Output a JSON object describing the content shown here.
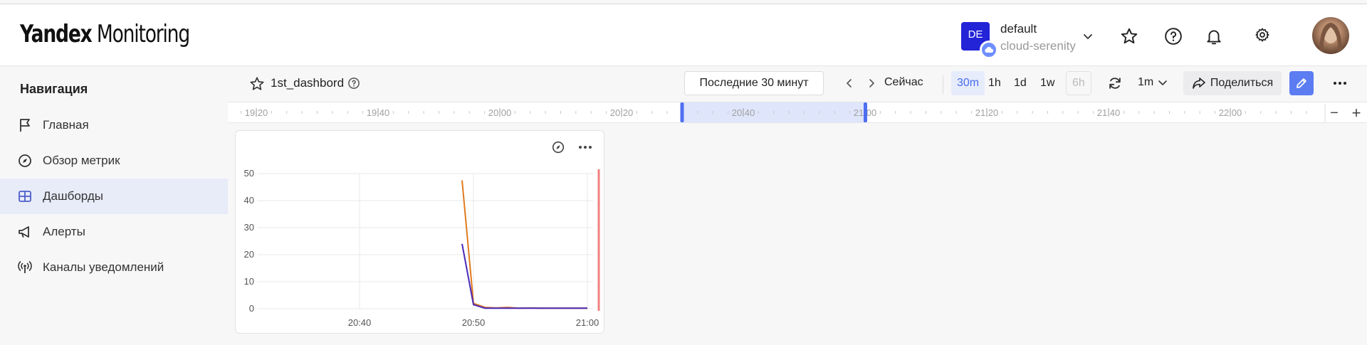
{
  "header": {
    "logo_bold": "Yandex",
    "logo_light": " Monitoring",
    "account": {
      "badge": "DE",
      "name": "default",
      "subtitle": "cloud-serenity"
    },
    "icons": [
      "star-icon",
      "help-icon",
      "bell-icon",
      "gear-icon"
    ]
  },
  "sidebar": {
    "title": "Навигация",
    "items": [
      {
        "label": "Главная",
        "icon": "flag-icon",
        "active": false
      },
      {
        "label": "Обзор метрик",
        "icon": "compass-icon",
        "active": false
      },
      {
        "label": "Дашборды",
        "icon": "dashboard-icon",
        "active": true
      },
      {
        "label": "Алерты",
        "icon": "megaphone-icon",
        "active": false
      },
      {
        "label": "Каналы уведомлений",
        "icon": "broadcast-icon",
        "active": false
      }
    ]
  },
  "dashboard": {
    "name": "1st_dashbord",
    "range_label": "Последние 30 минут",
    "now_label": "Сейчас",
    "periods": [
      {
        "label": "30m",
        "state": "active"
      },
      {
        "label": "1h",
        "state": "normal"
      },
      {
        "label": "1d",
        "state": "normal"
      },
      {
        "label": "1w",
        "state": "normal"
      },
      {
        "label": "6h",
        "state": "disabled"
      }
    ],
    "refresh_interval": "1m",
    "share_label": "Поделиться"
  },
  "timeline": {
    "labels": [
      "19:20",
      "19:40",
      "20:00",
      "20:20",
      "20:40",
      "21:00",
      "21:20",
      "21:40",
      "22:00"
    ],
    "selection": [
      "20:30",
      "21:00"
    ],
    "zoom_out": "−",
    "zoom_in": "+"
  },
  "chart_data": {
    "type": "line",
    "x_unit": "time (HH:MM)",
    "xticks": [
      "20:40",
      "20:50",
      "21:00"
    ],
    "yticks": [
      0,
      10,
      20,
      30,
      40,
      50
    ],
    "ylim": [
      0,
      50
    ],
    "xlim": [
      "20:31",
      "21:01"
    ],
    "grid": true,
    "series": [
      {
        "color": "#e07a1f",
        "points": [
          [
            "20:49",
            47.5
          ],
          [
            "20:50",
            2.0
          ],
          [
            "20:51",
            0.5
          ],
          [
            "20:52",
            0.3
          ],
          [
            "20:53",
            0.5
          ],
          [
            "20:54",
            0.2
          ],
          [
            "20:55",
            0.3
          ],
          [
            "20:56",
            0.2
          ],
          [
            "20:57",
            0.2
          ],
          [
            "20:58",
            0.2
          ],
          [
            "20:59",
            0.2
          ],
          [
            "21:00",
            0.2
          ]
        ]
      },
      {
        "color": "#4a2ab8",
        "points": [
          [
            "20:49",
            24.0
          ],
          [
            "20:50",
            1.5
          ],
          [
            "20:51",
            0.2
          ],
          [
            "20:52",
            0.2
          ],
          [
            "20:53",
            0.2
          ],
          [
            "20:54",
            0.2
          ],
          [
            "20:55",
            0.2
          ],
          [
            "20:56",
            0.2
          ],
          [
            "20:57",
            0.2
          ],
          [
            "20:58",
            0.2
          ],
          [
            "20:59",
            0.2
          ],
          [
            "21:00",
            0.2
          ]
        ]
      }
    ],
    "now_marker": "21:01",
    "now_marker_color": "#f08080"
  }
}
